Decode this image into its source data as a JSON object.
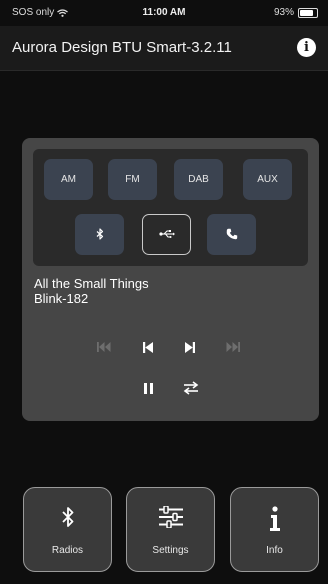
{
  "status": {
    "carrier": "SOS only",
    "time": "11:00 AM",
    "battery_label": "93%",
    "battery_level": 0.93
  },
  "header": {
    "title": "Aurora Design BTU Smart-3.2.11"
  },
  "modes": [
    {
      "label": "AM"
    },
    {
      "label": "FM"
    },
    {
      "label": "DAB"
    },
    {
      "label": "AUX"
    }
  ],
  "sources": [
    {
      "icon": "bluetooth-icon"
    },
    {
      "icon": "usb-icon",
      "active": true
    },
    {
      "icon": "phone-icon"
    }
  ],
  "now_playing": {
    "title": "All the Small Things",
    "artist": "Blink-182"
  },
  "bottom_nav": {
    "radios": {
      "label": "Radios",
      "icon": "bluetooth-icon"
    },
    "settings": {
      "label": "Settings",
      "icon": "sliders-icon"
    },
    "info": {
      "label": "Info",
      "icon": "info-icon"
    }
  },
  "colors": {
    "background": "#0e0e0e",
    "panel": "#464646",
    "mode_button": "#3b4350",
    "disabled_control": "#6e6e6e"
  }
}
